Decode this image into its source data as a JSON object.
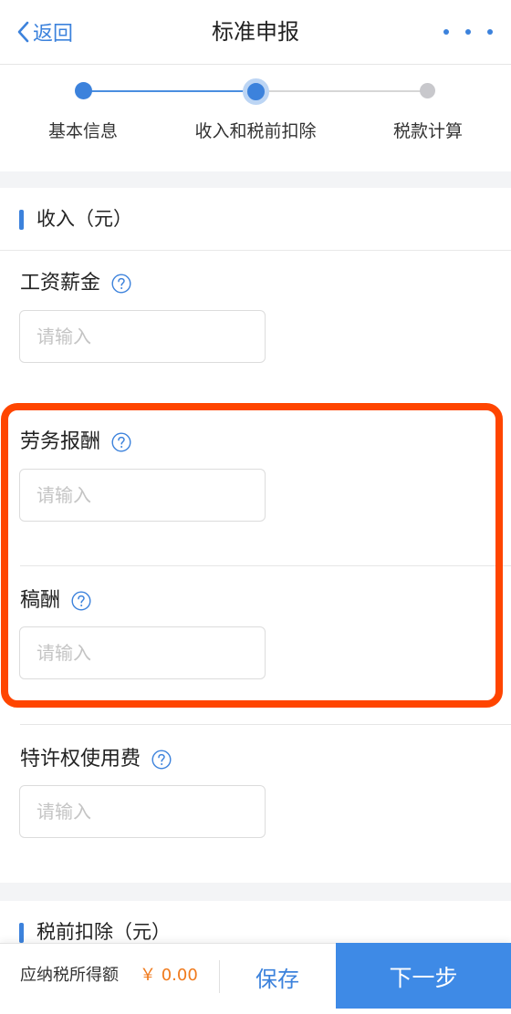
{
  "nav": {
    "back_label": "返回",
    "title": "标准申报",
    "accent_color": "#3c82dc"
  },
  "stepper": {
    "current_step": 2,
    "steps": [
      {
        "label": "基本信息",
        "state": "done"
      },
      {
        "label": "收入和税前扣除",
        "state": "current"
      },
      {
        "label": "税款计算",
        "state": "todo"
      }
    ]
  },
  "income_section": {
    "title": "收入（元）",
    "fields": [
      {
        "label": "工资薪金",
        "placeholder": "请输入",
        "value": "",
        "icon": "help-circle-icon"
      },
      {
        "label": "劳务报酬",
        "placeholder": "请输入",
        "value": "",
        "icon": "help-circle-icon"
      },
      {
        "label": "稿酬",
        "placeholder": "请输入",
        "value": "",
        "icon": "help-circle-icon"
      },
      {
        "label": "特许权使用费",
        "placeholder": "请输入",
        "value": "",
        "icon": "help-circle-icon"
      }
    ]
  },
  "deduction_section": {
    "title": "税前扣除（元）"
  },
  "highlight": {
    "color": "#ff4500"
  },
  "bottom_bar": {
    "tax_label": "应纳税所得额",
    "tax_amount": "￥ 0.00",
    "tax_amount_color": "#f07a1c",
    "save_label": "保存",
    "next_label": "下一步",
    "next_bg_color": "#3e8ae6"
  }
}
